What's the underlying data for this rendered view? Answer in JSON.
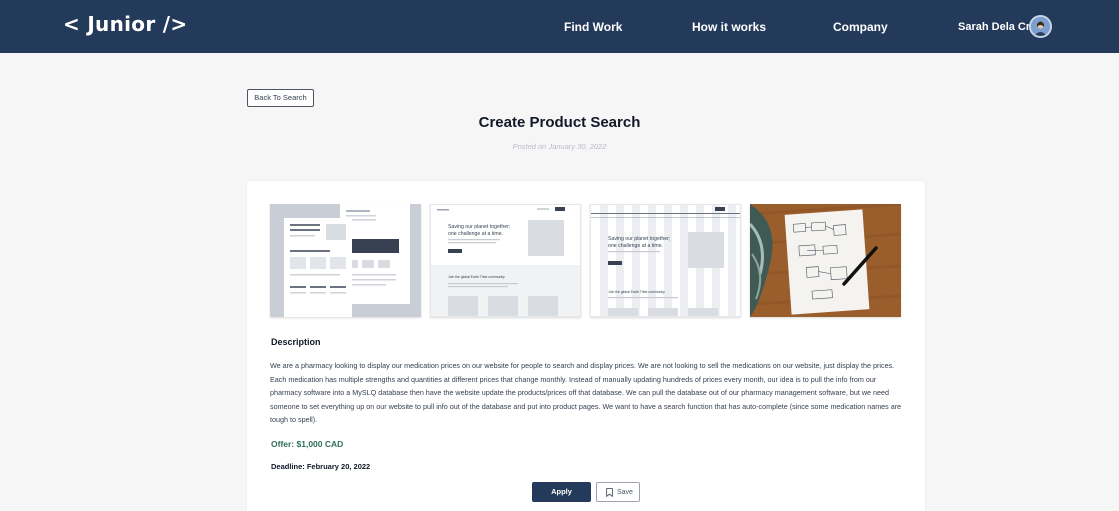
{
  "nav": {
    "logo": "< Junior />",
    "links": [
      "Find Work",
      "How it works",
      "Company"
    ],
    "user_name": "Sarah Dela Cruz"
  },
  "back_label": "Back To Search",
  "title": "Create Product Search",
  "posted": "Posted on January 30, 2022",
  "gallery": {
    "thumb2_headline_1": "Saving our planet together;",
    "thumb2_headline_2": "one challenge at a time.",
    "thumb2_community": "Join the global Earth Tribe community",
    "thumb3_headline_1": "Saving our planet together;",
    "thumb3_headline_2": "one challenge at a time.",
    "thumb3_community": "Join the global Earth Tribe community"
  },
  "description": {
    "heading": "Description",
    "text": "We are a pharmacy looking to display our medication prices on our website for people to search and display prices. We are not looking to sell the medications on our website, just display the prices. Each medication has multiple strengths and quantities at different prices that change monthly. Instead of manually updating hundreds of prices every month, our idea is to pull the info from our pharmacy software into a MySLQ database then have the website update the products/prices off that database. We can pull the database out of our pharmacy management software, but we need someone to set everything up on our website to pull info out of the database and put into product pages. We want to have a search function that has auto-complete (since some medication names are tough to spell)."
  },
  "offer": "Offer: $1,000 CAD",
  "deadline": "Deadline: February 20, 2022",
  "actions": {
    "apply": "Apply",
    "save": "Save"
  },
  "colors": {
    "navbar": "#243a5a",
    "offer": "#2f6f5e",
    "apply": "#243a5a"
  },
  "icons": {
    "avatar": "avatar",
    "save": "bookmark-icon"
  }
}
